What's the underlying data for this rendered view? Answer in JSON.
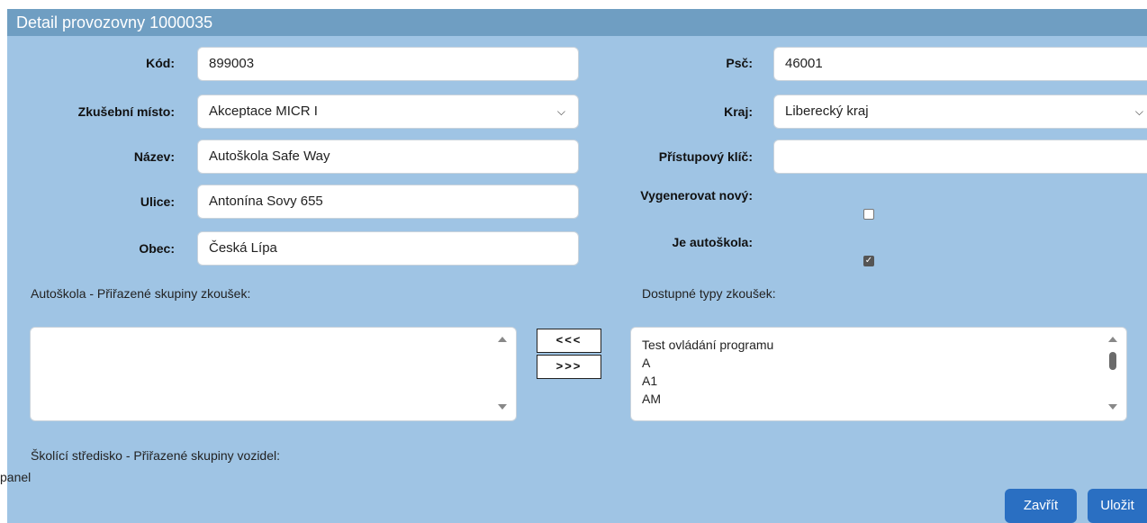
{
  "header": {
    "title": "Detail provozovny 1000035"
  },
  "form": {
    "kod": {
      "label": "Kód:",
      "value": "899003"
    },
    "zkusebni_misto": {
      "label": "Zkušební místo:",
      "value": "Akceptace MICR I"
    },
    "nazev": {
      "label": "Název:",
      "value": "Autoškola Safe Way"
    },
    "ulice": {
      "label": "Ulice:",
      "value": "Antonína Sovy 655"
    },
    "obec": {
      "label": "Obec:",
      "value": "Česká Lípa"
    },
    "psc": {
      "label": "Psč:",
      "value": "46001"
    },
    "kraj": {
      "label": "Kraj:",
      "value": "Liberecký kraj"
    },
    "pristupovy_klic": {
      "label": "Přístupový klíč:",
      "value": ""
    },
    "vygenerovat_novy": {
      "label": "Vygenerovat nový:",
      "checked": false
    },
    "je_autoskola": {
      "label": "Je autoškola:",
      "checked": true
    }
  },
  "assigned_groups": {
    "label": "Autoškola - Přiřazené skupiny zkoušek:",
    "items": []
  },
  "available_types": {
    "label": "Dostupné typy zkoušek:",
    "items": [
      "Test ovládání programu",
      "A",
      "A1",
      "AM"
    ]
  },
  "move_buttons": {
    "left": "<<<",
    "right": ">>>"
  },
  "vehicle_groups": {
    "label": "Školící středisko - Přiřazené skupiny vozidel:",
    "placeholder_text": "panel"
  },
  "icons": {
    "dropdown": "chevron-down-icon",
    "check": "checkmark-icon"
  },
  "footer": {
    "close_label": "Zavřít",
    "save_label": "Uložit"
  },
  "colors": {
    "panel_bg": "#9fc4e4",
    "title_bg": "#6f9ec2",
    "primary_button": "#2a6fc2"
  }
}
